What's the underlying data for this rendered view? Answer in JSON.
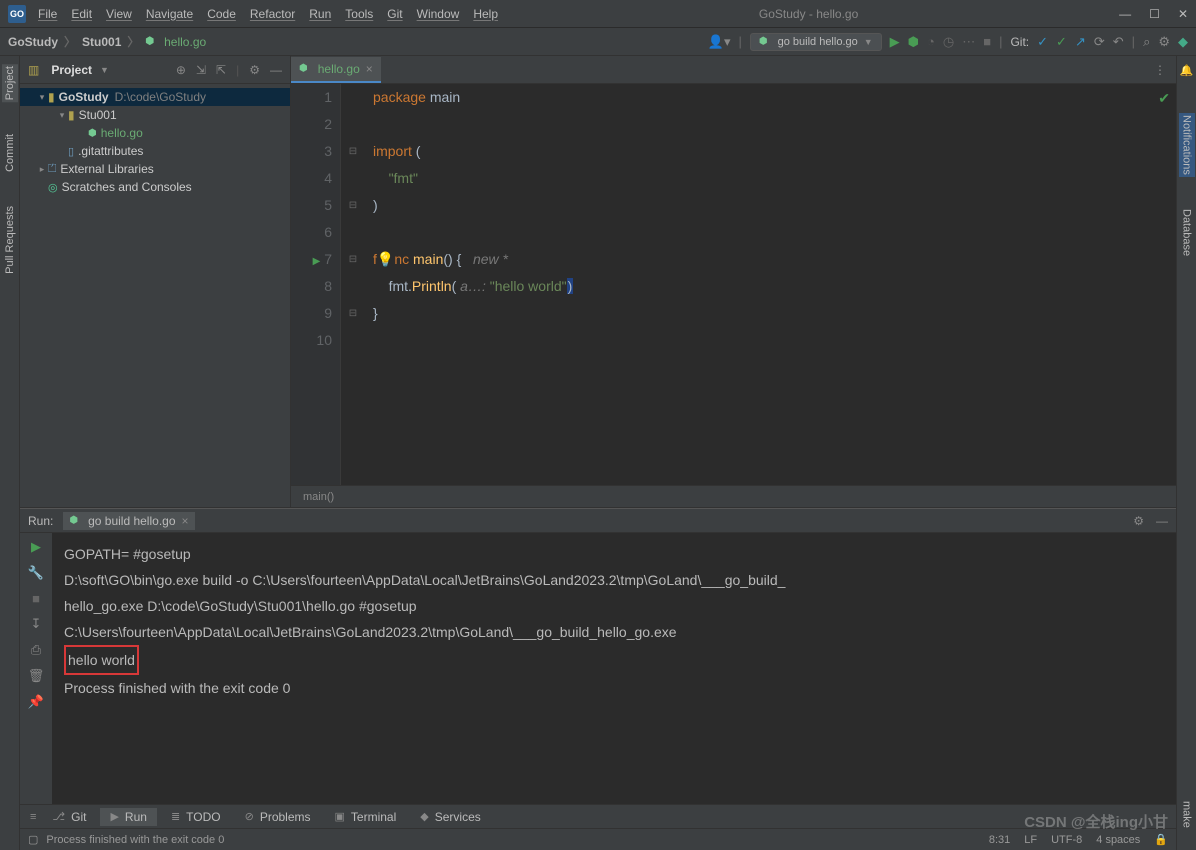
{
  "window": {
    "title": "GoStudy - hello.go",
    "app_badge": "GO"
  },
  "menu": [
    "File",
    "Edit",
    "View",
    "Navigate",
    "Code",
    "Refactor",
    "Run",
    "Tools",
    "Git",
    "Window",
    "Help"
  ],
  "breadcrumb": {
    "root": "GoStudy",
    "folder": "Stu001",
    "file": "hello.go"
  },
  "toolbar": {
    "run_config": "go build hello.go",
    "git_label": "Git:"
  },
  "left_tabs": [
    "Project",
    "Commit",
    "Pull Requests"
  ],
  "right_tabs": [
    "Notifications",
    "Database",
    "make"
  ],
  "project": {
    "header": "Project",
    "root": {
      "name": "GoStudy",
      "path": "D:\\code\\GoStudy"
    },
    "folder": "Stu001",
    "file": "hello.go",
    "gitattr": ".gitattributes",
    "ext_lib": "External Libraries",
    "scratches": "Scratches and Consoles"
  },
  "editor": {
    "tab_name": "hello.go",
    "lines": {
      "l1": "package",
      "l1b": "main",
      "l3": "import",
      "l3b": "(",
      "l4": "\"fmt\"",
      "l5": ")",
      "l7a": "f",
      "l7b": "nc",
      "l7c": "main",
      "l7d": "() {",
      "l7hint": "new *",
      "l8a": "fmt.",
      "l8b": "Println",
      "l8c": "(",
      "l8hint": " a…:",
      "l8str": " \"hello world\"",
      "l8d": ")",
      "l9": "}"
    },
    "breadcrumb_bottom": "main()"
  },
  "run": {
    "label": "Run:",
    "tab": "go build hello.go",
    "output": [
      "GOPATH= #gosetup",
      "D:\\soft\\GO\\bin\\go.exe build -o C:\\Users\\fourteen\\AppData\\Local\\JetBrains\\GoLand2023.2\\tmp\\GoLand\\___go_build_",
      "hello_go.exe D:\\code\\GoStudy\\Stu001\\hello.go #gosetup",
      "C:\\Users\\fourteen\\AppData\\Local\\JetBrains\\GoLand2023.2\\tmp\\GoLand\\___go_build_hello_go.exe",
      "hello world",
      "",
      "Process finished with the exit code 0"
    ]
  },
  "bottom_tabs": {
    "git": "Git",
    "run": "Run",
    "todo": "TODO",
    "problems": "Problems",
    "terminal": "Terminal",
    "services": "Services"
  },
  "status": {
    "msg": "Process finished with the exit code 0",
    "pos": "8:31",
    "enc": "UTF-8",
    "indent": "LF",
    "spaces": "4 spaces"
  },
  "watermark": "CSDN @全栈ing小甘"
}
